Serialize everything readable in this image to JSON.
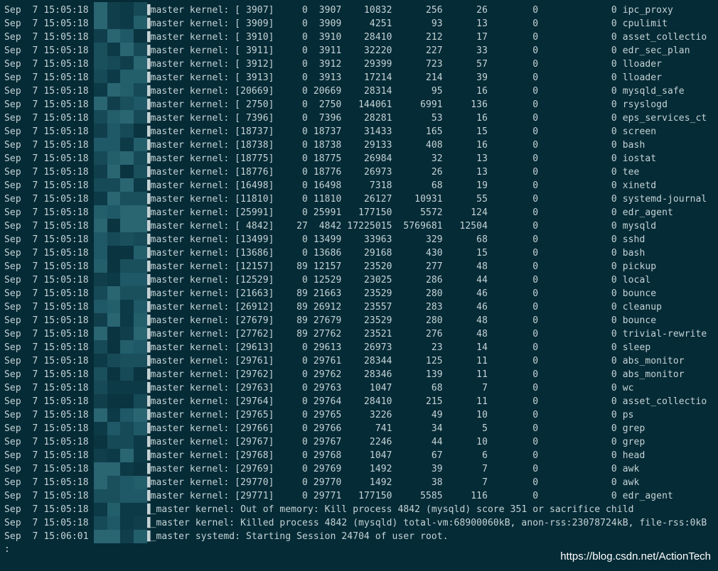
{
  "terminal": {
    "lines": [
      "Sep  7 15:05:18 ██████████master kernel: [ 3907]     0  3907    10832      256      26        0             0 ipc_proxy",
      "Sep  7 15:05:18 ██████████master kernel: [ 3909]     0  3909     4251       93      13        0             0 cpulimit",
      "Sep  7 15:05:18 ██████████master kernel: [ 3910]     0  3910    28410      212      17        0             0 asset_collectio",
      "Sep  7 15:05:18 ██████████master kernel: [ 3911]     0  3911    32220      227      33        0             0 edr_sec_plan",
      "Sep  7 15:05:18 ██████████master kernel: [ 3912]     0  3912    29399      723      57        0             0 lloader",
      "Sep  7 15:05:18 ██████████master kernel: [ 3913]     0  3913    17214      214      39        0             0 lloader",
      "Sep  7 15:05:18 ██████████master kernel: [20669]     0 20669    28314       95      16        0             0 mysqld_safe",
      "Sep  7 15:05:18 ██████████master kernel: [ 2750]     0  2750   144061     6991     136        0             0 rsyslogd",
      "Sep  7 15:05:18 ██████████master kernel: [ 7396]     0  7396    28281       53      16        0             0 eps_services_ct",
      "Sep  7 15:05:18 ██████████master kernel: [18737]     0 18737    31433      165      15        0             0 screen",
      "Sep  7 15:05:18 ██████████master kernel: [18738]     0 18738    29133      408      16        0             0 bash",
      "Sep  7 15:05:18 ██████████master kernel: [18775]     0 18775    26984       32      13        0             0 iostat",
      "Sep  7 15:05:18 ██████████master kernel: [18776]     0 18776    26973       26      13        0             0 tee",
      "Sep  7 15:05:18 ██████████master kernel: [16498]     0 16498     7318       68      19        0             0 xinetd",
      "Sep  7 15:05:18 ██████████master kernel: [11810]     0 11810    26127    10931      55        0             0 systemd-journal",
      "Sep  7 15:05:18 ██████████master kernel: [25991]     0 25991   177150     5572     124        0             0 edr_agent",
      "Sep  7 15:05:18 ██████████master kernel: [ 4842]    27  4842 17225015  5769681   12504        0             0 mysqld",
      "Sep  7 15:05:18 ██████████master kernel: [13499]     0 13499    33963      329      68        0             0 sshd",
      "Sep  7 15:05:18 ██████████master kernel: [13686]     0 13686    29168      430      15        0             0 bash",
      "Sep  7 15:05:18 ██████████master kernel: [12157]    89 12157    23520      277      48        0             0 pickup",
      "Sep  7 15:05:18 ██████████master kernel: [12529]     0 12529    23025      286      44        0             0 local",
      "Sep  7 15:05:18 ██████████master kernel: [21663]    89 21663    23529      280      46        0             0 bounce",
      "Sep  7 15:05:18 ██████████master kernel: [26912]    89 26912    23557      283      46        0             0 cleanup",
      "Sep  7 15:05:18 ██████████master kernel: [27679]    89 27679    23529      280      48        0             0 bounce",
      "Sep  7 15:05:18 ██████████master kernel: [27762]    89 27762    23521      276      48        0             0 trivial-rewrite",
      "Sep  7 15:05:18 ██████████master kernel: [29613]     0 29613    26973       23      14        0             0 sleep",
      "Sep  7 15:05:18 ██████████master kernel: [29761]     0 29761    28344      125      11        0             0 abs_monitor",
      "Sep  7 15:05:18 ██████████master kernel: [29762]     0 29762    28346      139      11        0             0 abs_monitor",
      "Sep  7 15:05:18 ██████████master kernel: [29763]     0 29763     1047       68       7        0             0 wc",
      "Sep  7 15:05:18 ██████████master kernel: [29764]     0 29764    28410      215      11        0             0 asset_collectio",
      "Sep  7 15:05:18 ██████████master kernel: [29765]     0 29765     3226       49      10        0             0 ps",
      "Sep  7 15:05:18 ██████████master kernel: [29766]     0 29766      741       34       5        0             0 grep",
      "Sep  7 15:05:18 ██████████master kernel: [29767]     0 29767     2246       44      10        0             0 grep",
      "Sep  7 15:05:18 ██████████master kernel: [29768]     0 29768     1047       67       6        0             0 head",
      "Sep  7 15:05:18 ██████████master kernel: [29769]     0 29769     1492       39       7        0             0 awk",
      "Sep  7 15:05:18 ██████████master kernel: [29770]     0 29770     1492       38       7        0             0 awk",
      "Sep  7 15:05:18 ██████████master kernel: [29771]     0 29771   177150     5585     116        0             0 edr_agent",
      "Sep  7 15:05:18 ██████████_master kernel: Out of memory: Kill process 4842 (mysqld) score 351 or sacrifice child",
      "Sep  7 15:05:18 ██████████_master kernel: Killed process 4842 (mysqld) total-vm:68900060kB, anon-rss:23078724kB, file-rss:0kB",
      "Sep  7 15:06:01 ██████████_master systemd: Starting Session 24704 of user root."
    ],
    "prompt": ":"
  },
  "watermark": "https://blog.csdn.net/ActionTech",
  "colors": {
    "background": "#052b36",
    "text": "#c5d3d6",
    "watermark": "#ffffff"
  }
}
